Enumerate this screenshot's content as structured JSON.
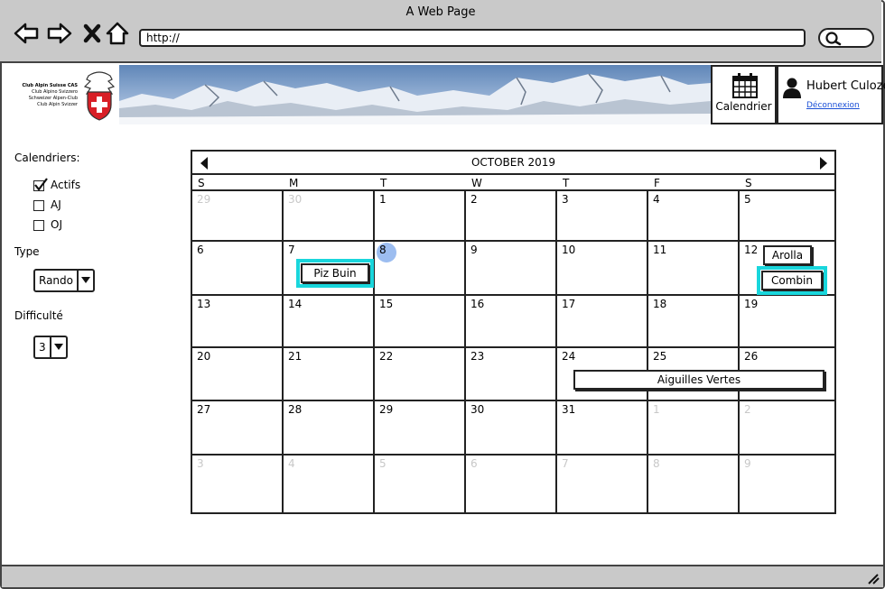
{
  "window": {
    "title": "A Web Page",
    "url": "http://"
  },
  "banner": {
    "logo_lines": [
      "Club Alpin Suisse CAS",
      "Club Alpino Svizzero",
      "Schweizer Alpen-Club",
      "Club Alpin Svizzer"
    ],
    "calendar_label": "Calendrier",
    "user_name": "Hubert Culoze",
    "logout_label": "Déconnexion"
  },
  "sidebar": {
    "calendars_label": "Calendriers:",
    "calendars": [
      {
        "label": "Actifs",
        "checked": true
      },
      {
        "label": "AJ",
        "checked": false
      },
      {
        "label": "OJ",
        "checked": false
      }
    ],
    "type_label": "Type",
    "type_value": "Rando",
    "difficulty_label": "Difficulté",
    "difficulty_value": "3"
  },
  "calendar": {
    "month_title": "OCTOBER 2019",
    "weekdays": [
      "S",
      "M",
      "T",
      "W",
      "T",
      "F",
      "S"
    ],
    "weeks": [
      [
        {
          "d": "29",
          "m": true
        },
        {
          "d": "30",
          "m": true
        },
        {
          "d": "1"
        },
        {
          "d": "2"
        },
        {
          "d": "3"
        },
        {
          "d": "4"
        },
        {
          "d": "5"
        }
      ],
      [
        {
          "d": "6"
        },
        {
          "d": "7"
        },
        {
          "d": "8",
          "today": true
        },
        {
          "d": "9"
        },
        {
          "d": "10"
        },
        {
          "d": "11"
        },
        {
          "d": "12"
        }
      ],
      [
        {
          "d": "13"
        },
        {
          "d": "14"
        },
        {
          "d": "15"
        },
        {
          "d": "16"
        },
        {
          "d": "17"
        },
        {
          "d": "18"
        },
        {
          "d": "19"
        }
      ],
      [
        {
          "d": "20"
        },
        {
          "d": "21"
        },
        {
          "d": "22"
        },
        {
          "d": "23"
        },
        {
          "d": "24"
        },
        {
          "d": "25"
        },
        {
          "d": "26"
        }
      ],
      [
        {
          "d": "27"
        },
        {
          "d": "28"
        },
        {
          "d": "29"
        },
        {
          "d": "30"
        },
        {
          "d": "31"
        },
        {
          "d": "1",
          "m": true
        },
        {
          "d": "2",
          "m": true
        }
      ],
      [
        {
          "d": "3",
          "m": true
        },
        {
          "d": "4",
          "m": true
        },
        {
          "d": "5",
          "m": true
        },
        {
          "d": "6",
          "m": true
        },
        {
          "d": "7",
          "m": true
        },
        {
          "d": "8",
          "m": true
        },
        {
          "d": "9",
          "m": true
        }
      ]
    ],
    "events": {
      "piz_buin": "Piz Buin",
      "arolla": "Arolla",
      "combin": "Combin",
      "aiguilles": "Aiguilles Vertes"
    }
  },
  "colors": {
    "chrome": "#c9c9c9",
    "highlight": "#19d6dc",
    "today": "#9cbdf0",
    "link": "#1a4fd6"
  }
}
